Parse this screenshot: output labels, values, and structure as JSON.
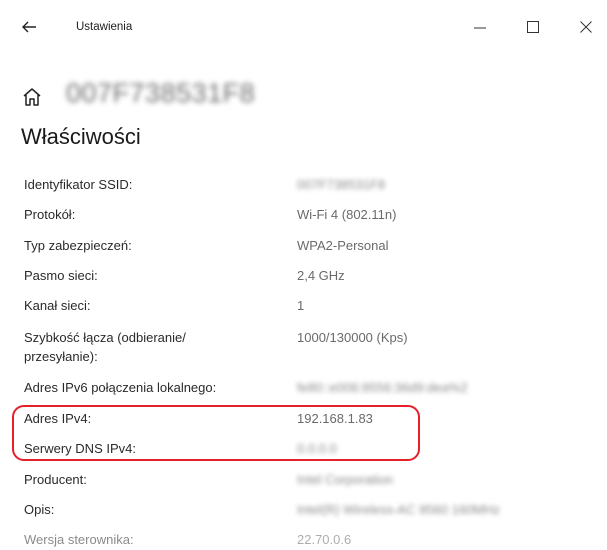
{
  "window": {
    "title": "Ustawienia",
    "back_icon": "arrow-left-icon",
    "controls": [
      "minimize-icon",
      "maximize-icon",
      "close-icon"
    ]
  },
  "header": {
    "network_name": "007F738531F8",
    "page_title": "Właściwości"
  },
  "properties": [
    {
      "label": "Identyfikator SSID:",
      "value": "007F738531F8",
      "blurred": true
    },
    {
      "label": "Protokół:",
      "value": "Wi-Fi 4 (802.11n)"
    },
    {
      "label": "Typ zabezpieczeń:",
      "value": "WPA2-Personal"
    },
    {
      "label": "Pasmo sieci:",
      "value": "2,4 GHz"
    },
    {
      "label": "Kanał sieci:",
      "value": "1"
    },
    {
      "label": "Szybkość łącza (odbieranie/",
      "label2": "przesyłanie):",
      "value": "1000/130000 (Kps)"
    },
    {
      "label": "Adres IPv6 połączenia lokalnego:",
      "value": "fe80::e006:9556:36d9:dea%2",
      "blurred": true
    },
    {
      "label": "Adres IPv4:",
      "value": "192.168.1.83"
    },
    {
      "label": "Serwery DNS IPv4:",
      "value": "0.0.0.0",
      "blurred": true
    },
    {
      "label": "Producent:",
      "value": "Intel Corporation",
      "blurred": true
    },
    {
      "label": "Opis:",
      "value": "Intel(R) Wireless-AC 9560 160MHz",
      "blurred": true
    },
    {
      "label": "Wersja sterownika:",
      "value": "22.70.0.6"
    }
  ],
  "highlight_color": "#e4202b"
}
